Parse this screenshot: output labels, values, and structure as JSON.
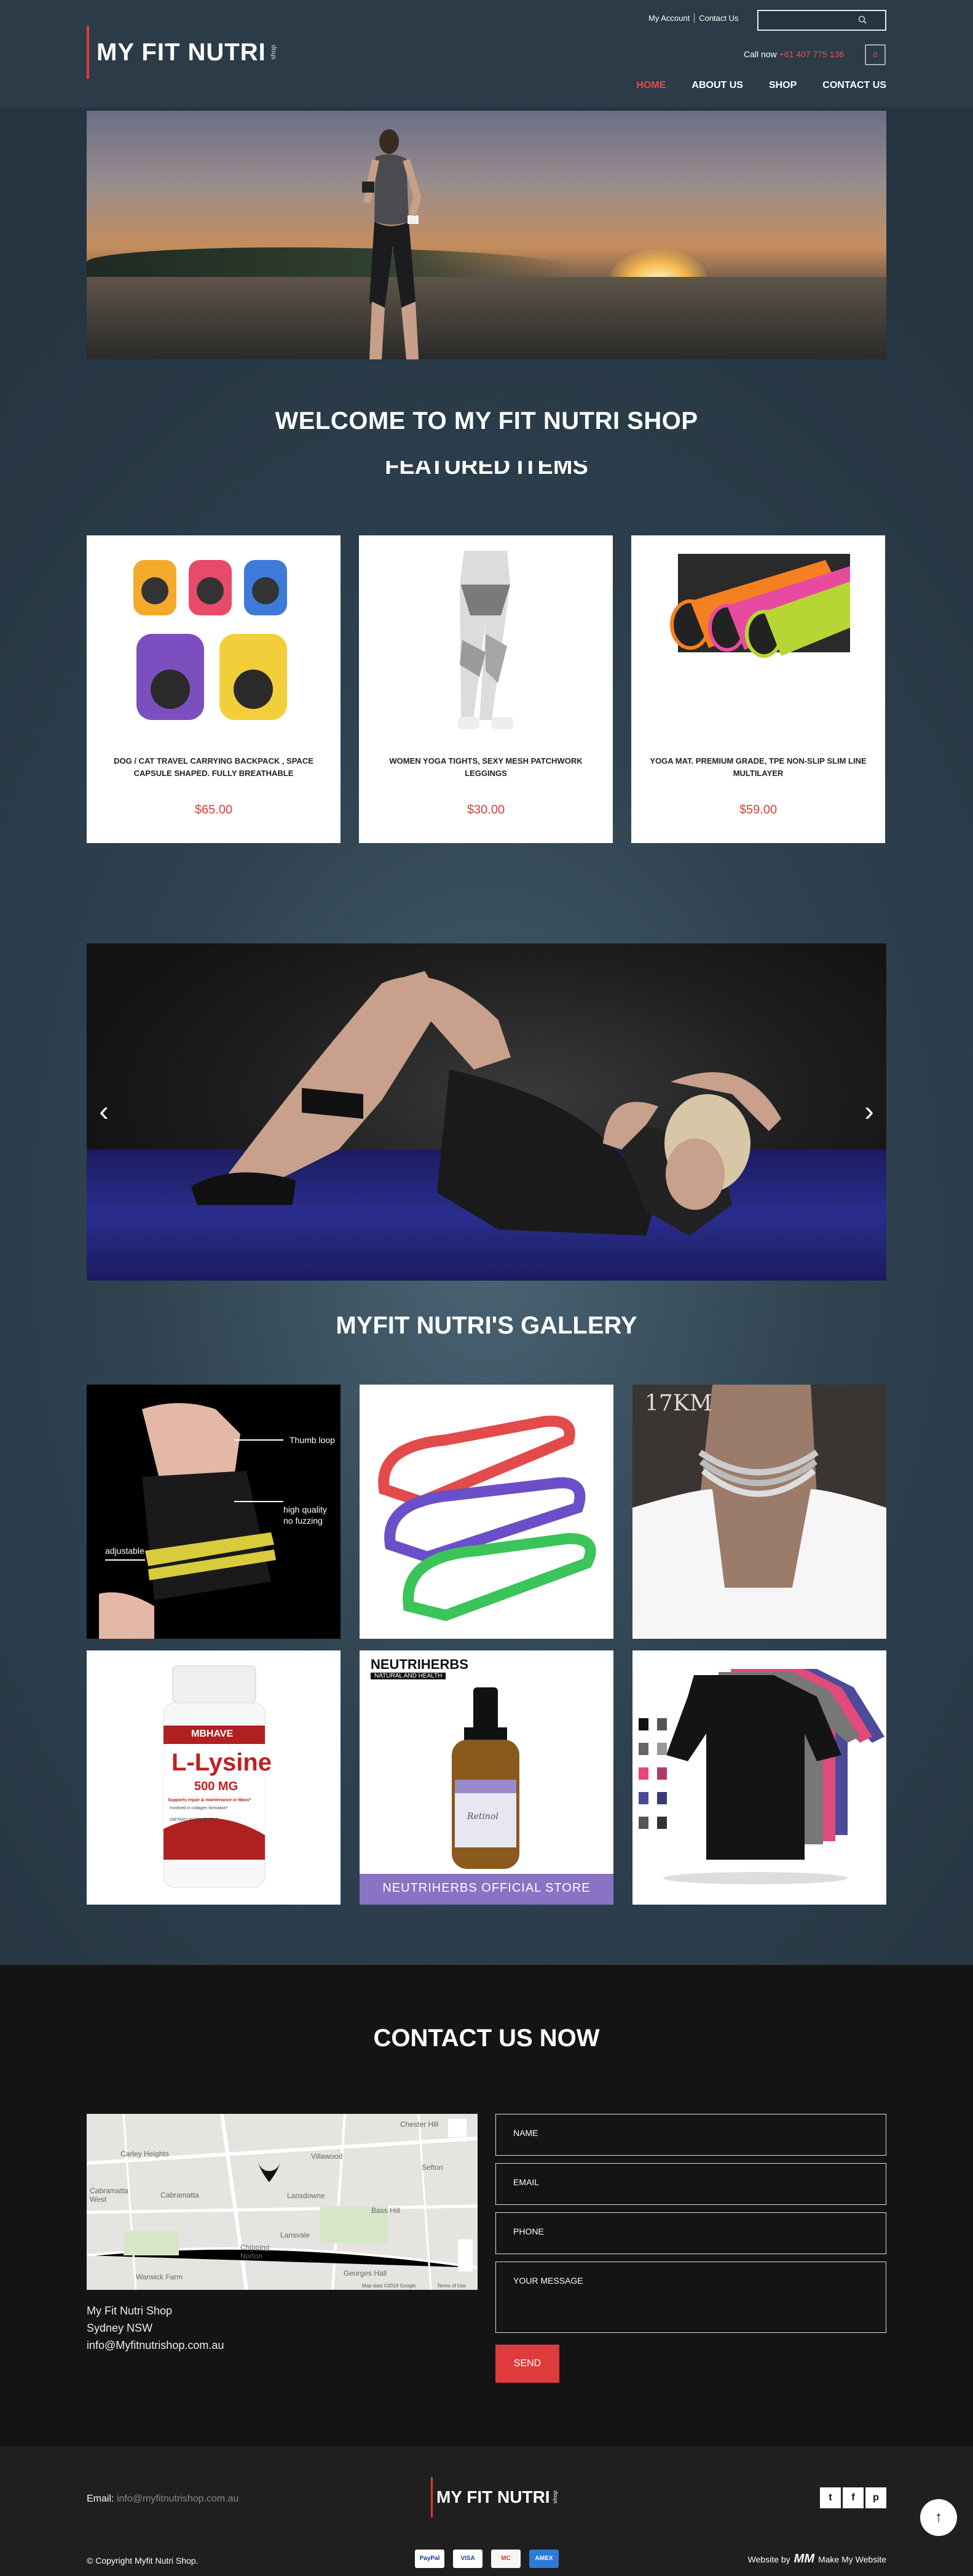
{
  "header": {
    "logo_text": "MY FIT NUTRI",
    "logo_small": "shop",
    "top_links": [
      "My Account",
      "Contact Us"
    ],
    "call_label": "Call now",
    "call_number": "+61 407 775 136",
    "cart_count": "0",
    "nav": [
      {
        "label": "HOME",
        "active": true
      },
      {
        "label": "ABOUT US",
        "active": false
      },
      {
        "label": "SHOP",
        "active": false
      },
      {
        "label": "CONTACT US",
        "active": false
      }
    ]
  },
  "headings": {
    "welcome": "WELCOME TO MY FIT NUTRI SHOP",
    "featured": "FEATURED ITEMS",
    "gallery": "MYFIT NUTRI'S GALLERY",
    "contact": "CONTACT US NOW"
  },
  "products": [
    {
      "name": "DOG / CAT TRAVEL CARRYING BACKPACK , SPACE CAPSULE SHAPED. FULLY BREATHABLE",
      "price": "$65.00"
    },
    {
      "name": "WOMEN YOGA TIGHTS, SEXY MESH PATCHWORK LEGGINGS",
      "price": "$30.00"
    },
    {
      "name": "YOGA MAT. PREMIUM GRADE, TPE NON-SLIP SLIM LINE MULTILAYER",
      "price": "$59.00"
    }
  ],
  "slider": {
    "prev": "‹",
    "next": "›"
  },
  "gallery": {
    "wrist_labels": [
      "Thumb loop",
      "high quality",
      "no fuzzing",
      "adjustable"
    ],
    "jewelry_label": "17KM",
    "lysine_brand": "MBHAVE",
    "lysine_name": "L-Lysine",
    "lysine_dose": "500 MG",
    "lysine_claim": "Supports repair & maintenance or Mass*",
    "lysine_claim2": "Involved in collagen formation*",
    "lysine_supplement": "DIETARY SUPPLEMENT",
    "serum_brand": "NEUTRIHERBS",
    "serum_tag": "NATURAL AND HEALTH",
    "serum_label": "Retinol",
    "serum_store": "NEUTRIHERBS OFFICIAL STORE"
  },
  "contact": {
    "map_labels": [
      "Chester Hill",
      "Carley Heights",
      "Villawood",
      "Sefton",
      "Cabramatta West",
      "Cabramatta",
      "Lansdowne",
      "Bass Hill",
      "Lansvale",
      "Chipping Norton",
      "Georges Hall",
      "Warwick Farm",
      "Map data ©2019 Google",
      "Terms of Use"
    ],
    "address": [
      "My Fit Nutri Shop",
      "Sydney NSW",
      "info@Myfitnutrishop.com.au"
    ],
    "fields": [
      "NAME",
      "EMAIL",
      "PHONE",
      "YOUR MESSAGE"
    ],
    "send": "SEND"
  },
  "footer": {
    "email_label": "Email:",
    "email": "info@myfitnutrishop.com.au",
    "logo_text": "MY FIT NUTRI",
    "logo_small": "shop",
    "social": [
      "t",
      "f",
      "p"
    ],
    "copyright": "© Copyright Myfit Nutri Shop.",
    "payments": [
      "PayPal",
      "VISA",
      "MC",
      "AMEX"
    ],
    "website_by": "Website by",
    "maker_logo": "MM",
    "maker": "Make My Website"
  },
  "colors": {
    "accent": "#e03b3b",
    "bg": "#2b3b48",
    "footer": "#141414"
  }
}
